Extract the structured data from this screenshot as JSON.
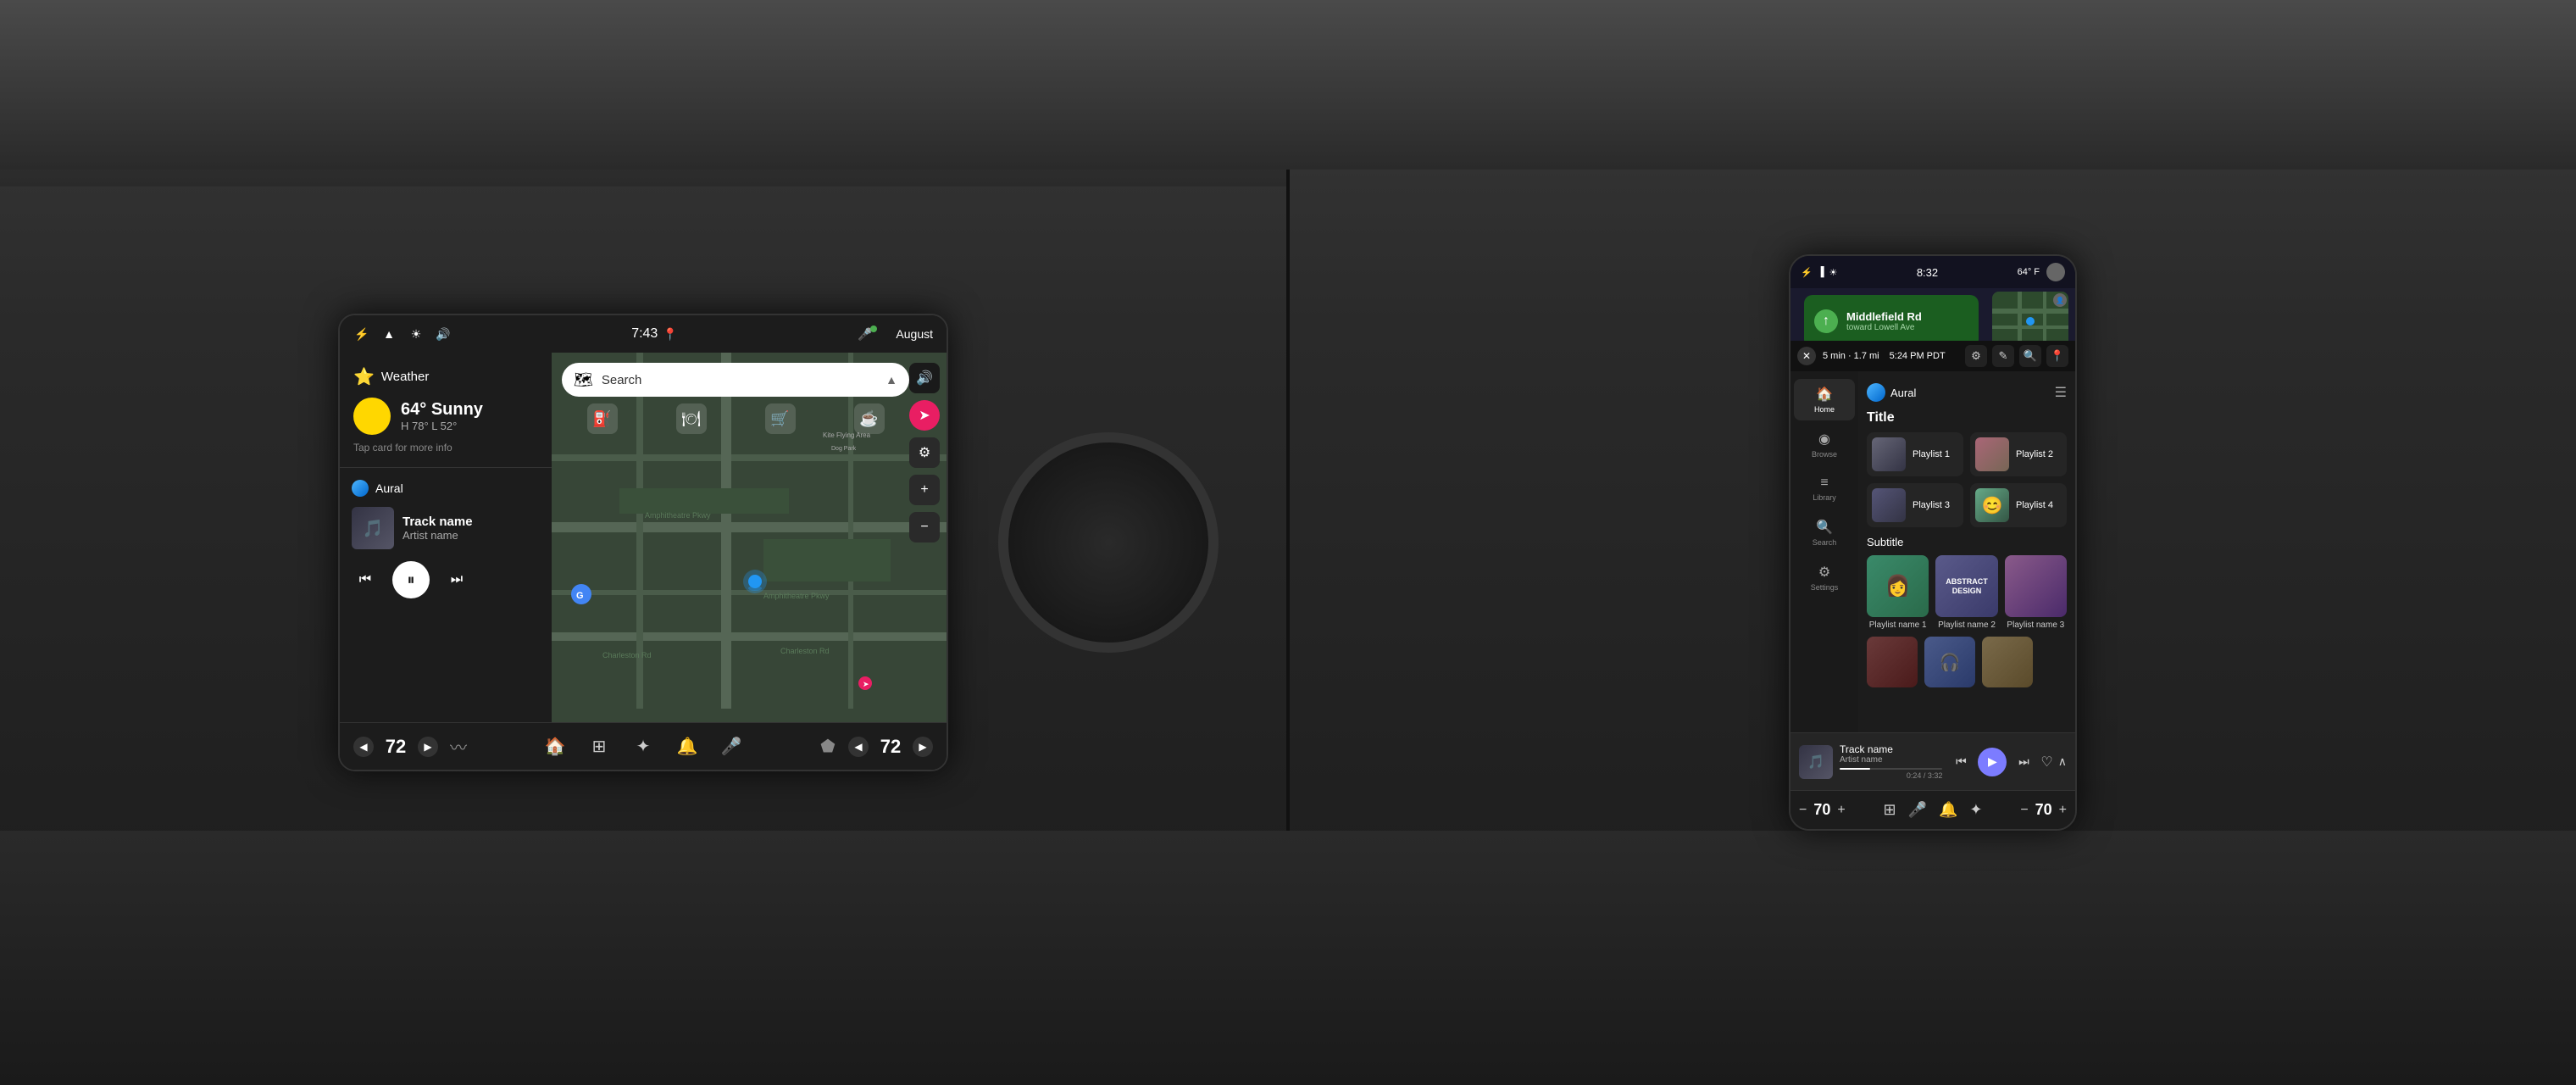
{
  "left": {
    "status_bar": {
      "time": "7:43",
      "user": "August",
      "mic_icon": "🎤",
      "bluetooth_icon": "⚡",
      "signal_icon": "📶",
      "brightness_icon": "☀",
      "volume_icon": "🔊"
    },
    "weather": {
      "label": "Weather",
      "temp": "64°",
      "condition": "Sunny",
      "high": "H 78°",
      "low": "L 52°",
      "tap_hint": "Tap card for more info"
    },
    "music": {
      "app_name": "Aural",
      "track_name": "Track name",
      "artist_name": "Artist name"
    },
    "map": {
      "search_placeholder": "Search"
    },
    "bottom_bar": {
      "temp_left": "72",
      "temp_right": "72"
    },
    "controls": {
      "prev": "⏮",
      "play": "⏸",
      "next": "⏭"
    }
  },
  "right": {
    "phone_status": {
      "time": "8:32",
      "temp": "64° F"
    },
    "navigation": {
      "street": "Middlefield Rd",
      "toward": "toward Lowell Ave",
      "eta": "5 min · 1.7 mi",
      "eta_time": "5:24 PM PDT"
    },
    "music_app": {
      "app_name": "Aural",
      "title_section": "Title",
      "subtitle_section": "Subtitle",
      "playlists": [
        {
          "name": "Playlist 1"
        },
        {
          "name": "Playlist 2"
        },
        {
          "name": "Playlist 3"
        },
        {
          "name": "Playlist 4"
        }
      ],
      "large_playlists": [
        {
          "name": "Playlist name 1"
        },
        {
          "name": "Playlist name 2"
        },
        {
          "name": "Playlist name 3"
        }
      ]
    },
    "sidebar": {
      "items": [
        {
          "label": "Home",
          "icon": "🏠"
        },
        {
          "label": "Browse",
          "icon": "🔍"
        },
        {
          "label": "Library",
          "icon": "📚"
        },
        {
          "label": "Search",
          "icon": "🔎"
        },
        {
          "label": "Settings",
          "icon": "⚙"
        }
      ]
    },
    "now_playing": {
      "track_name": "Track name",
      "artist_name": "Artist name",
      "progress": "0:24",
      "duration": "3:32"
    },
    "bottom_bar": {
      "temp_left": "70",
      "temp_right": "70"
    }
  }
}
